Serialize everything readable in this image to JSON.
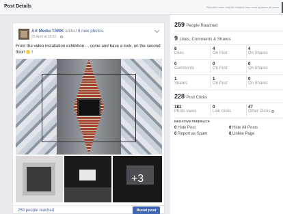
{
  "header": {
    "title": "Post Details",
    "notice": "Reported stats may be delayed from what appears on posts"
  },
  "post": {
    "author": "Art Media TAMK",
    "action_text": " added ",
    "action_link": "6 new photos.",
    "date": "25 April at 18:02 · ",
    "text": "From the video installation exhibition ... come and have a look, on the second floor! ",
    "text_suffix": "!",
    "extra_photos_count": "+3",
    "reached_link": "259 people reached",
    "boost_label": "Boost post"
  },
  "stats": {
    "reach_value": "259",
    "reach_label": "People Reached",
    "engagement_value": "9",
    "engagement_label": "Likes, Comments & Shares",
    "rows": [
      [
        {
          "value": "8",
          "label": "Likes"
        },
        {
          "value": "4",
          "label": "On Post"
        },
        {
          "value": "4",
          "label": "On Shares"
        }
      ],
      [
        {
          "value": "0",
          "label": "Comments"
        },
        {
          "value": "0",
          "label": "On Post"
        },
        {
          "value": "0",
          "label": "On Shares"
        }
      ],
      [
        {
          "value": "1",
          "label": "Shares"
        },
        {
          "value": "1",
          "label": "On Post"
        },
        {
          "value": "0",
          "label": "On Shares"
        }
      ]
    ],
    "clicks_value": "228",
    "clicks_label": "Post Clicks",
    "clicks": [
      {
        "value": "181",
        "label": "Photo views"
      },
      {
        "value": "0",
        "label": "Link clicks"
      },
      {
        "value": "47",
        "label": "Other Clicks"
      }
    ],
    "negative_heading": "NEGATIVE FEEDBACK",
    "negative": [
      {
        "value": "0",
        "label": "Hide Post"
      },
      {
        "value": "0",
        "label": "Hide All Posts"
      },
      {
        "value": "0",
        "label": "Report as Spam"
      },
      {
        "value": "0",
        "label": "Unlike Page"
      }
    ]
  }
}
